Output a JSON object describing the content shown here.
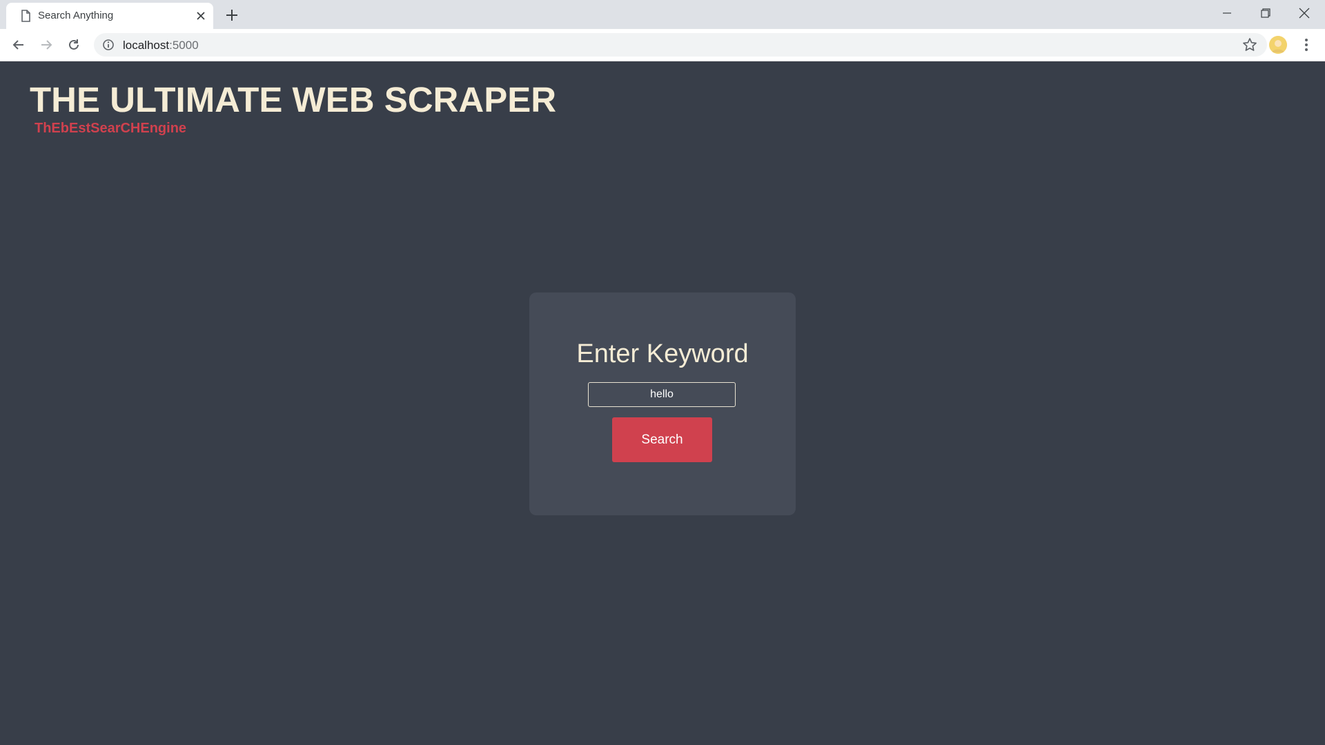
{
  "browser": {
    "tab_title": "Search Anything",
    "url_host": "localhost",
    "url_port": ":5000",
    "icons": [
      "page-icon",
      "close-icon",
      "plus-icon",
      "minimize-icon",
      "restore-icon",
      "window-close-icon",
      "back-arrow-icon",
      "forward-arrow-icon",
      "reload-icon",
      "info-icon",
      "star-icon",
      "avatar",
      "kebab-menu-icon"
    ]
  },
  "site": {
    "title": "THE ULTIMATE WEB SCRAPER",
    "subtitle": "ThEbEstSearCHEngine"
  },
  "search": {
    "heading": "Enter Keyword",
    "input_value": "hello",
    "button_label": "Search"
  },
  "colors": {
    "background": "#383e49",
    "card": "#454b57",
    "accent": "#d0414e",
    "title": "#f5ecd5"
  }
}
